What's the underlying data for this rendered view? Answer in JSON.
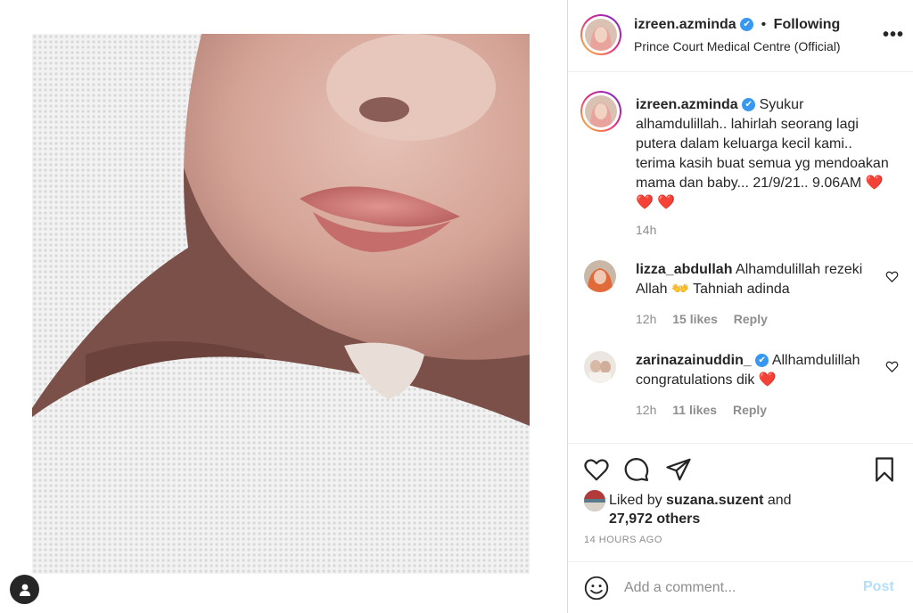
{
  "post": {
    "author": "izreen.azminda",
    "follow_status": "Following",
    "separator": "•",
    "location": "Prince Court Medical Centre (Official)",
    "more_icon": "more-horizontal-icon",
    "verified_mark": "✔"
  },
  "caption": {
    "username": "izreen.azminda",
    "text": "Syukur alhamdulillah.. lahirlah seorang lagi putera dalam keluarga kecil kami.. terima kasih buat semua yg mendoakan mama dan baby... 21/9/21.. 9.06AM ❤️ ❤️ ❤️",
    "age": "14h"
  },
  "comments": [
    {
      "username": "lizza_abdullah",
      "text": "Alhamdulillah rezeki Allah 👐 Tahniah adinda",
      "age": "12h",
      "likes": "15 likes",
      "reply_label": "Reply",
      "verified": false
    },
    {
      "username": "zarinazainuddin_",
      "text": "Allhamdulillah congratulations dik ❤️",
      "age": "12h",
      "likes": "11 likes",
      "reply_label": "Reply",
      "verified": true
    }
  ],
  "actions": {
    "like_icon": "heart-outline-icon",
    "comment_icon": "comment-bubble-icon",
    "share_icon": "paper-plane-icon",
    "save_icon": "bookmark-icon"
  },
  "likes": {
    "prefix": "Liked by",
    "user": "suzana.suzent",
    "conjunction": "and",
    "others": "27,972 others"
  },
  "timestamp": "14 HOURS AGO",
  "comment_box": {
    "placeholder": "Add a comment...",
    "post_label": "Post",
    "emoji_icon": "smiley-face-icon"
  },
  "colors": {
    "verified_blue": "#3897f0",
    "post_button_disabled": "#b2dffc",
    "secondary_text": "#8e8e8e",
    "heart_red": "#ed4956"
  }
}
